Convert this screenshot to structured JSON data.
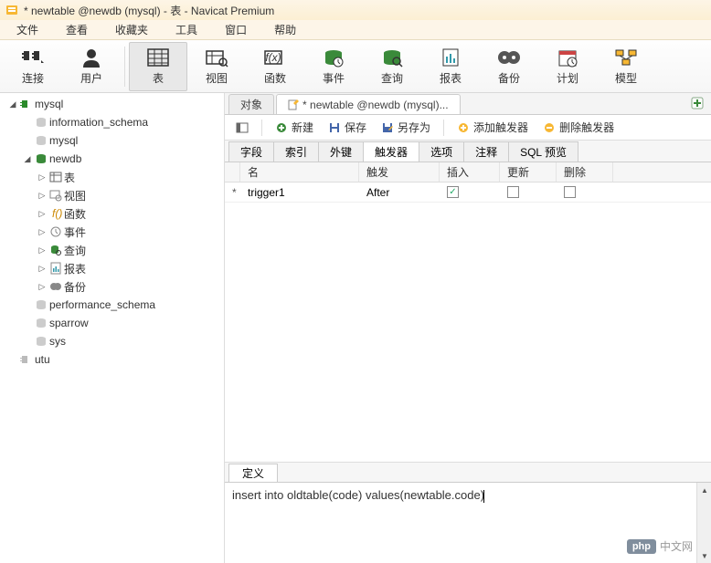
{
  "window": {
    "title": "* newtable @newdb (mysql) - 表 - Navicat Premium"
  },
  "menu": {
    "file": "文件",
    "view": "查看",
    "favorites": "收藏夹",
    "tools": "工具",
    "window": "窗口",
    "help": "帮助"
  },
  "toolbar": {
    "connect": "连接",
    "user": "用户",
    "table": "表",
    "view": "视图",
    "function": "函数",
    "event": "事件",
    "query": "查询",
    "report": "报表",
    "backup": "备份",
    "schedule": "计划",
    "model": "模型"
  },
  "tree": {
    "conn_mysql": "mysql",
    "db_information_schema": "information_schema",
    "db_mysql": "mysql",
    "db_newdb": "newdb",
    "nd_table": "表",
    "nd_view": "视图",
    "nd_function": "函数",
    "nd_event": "事件",
    "nd_query": "查询",
    "nd_report": "报表",
    "nd_backup": "备份",
    "db_performance_schema": "performance_schema",
    "db_sparrow": "sparrow",
    "db_sys": "sys",
    "conn_utu": "utu"
  },
  "contentTabs": {
    "objects": "对象",
    "editor": "* newtable @newdb (mysql)..."
  },
  "actions": {
    "new": "新建",
    "save": "保存",
    "saveAs": "另存为",
    "addTrigger": "添加触发器",
    "deleteTrigger": "删除触发器"
  },
  "sectionTabs": {
    "fields": "字段",
    "indexes": "索引",
    "foreignKeys": "外键",
    "triggers": "触发器",
    "options": "选项",
    "comments": "注释",
    "sqlPreview": "SQL 预览"
  },
  "gridHeaders": {
    "name": "名",
    "trigger": "触发",
    "insert": "插入",
    "update": "更新",
    "delete": "删除"
  },
  "triggerRow": {
    "marker": "*",
    "name": "trigger1",
    "when": "After",
    "insert": true,
    "update": false,
    "delete": false
  },
  "definition": {
    "tabLabel": "定义",
    "code": "insert into oldtable(code) values(newtable.code)"
  },
  "watermark": {
    "brand": "php",
    "text": "中文网"
  }
}
